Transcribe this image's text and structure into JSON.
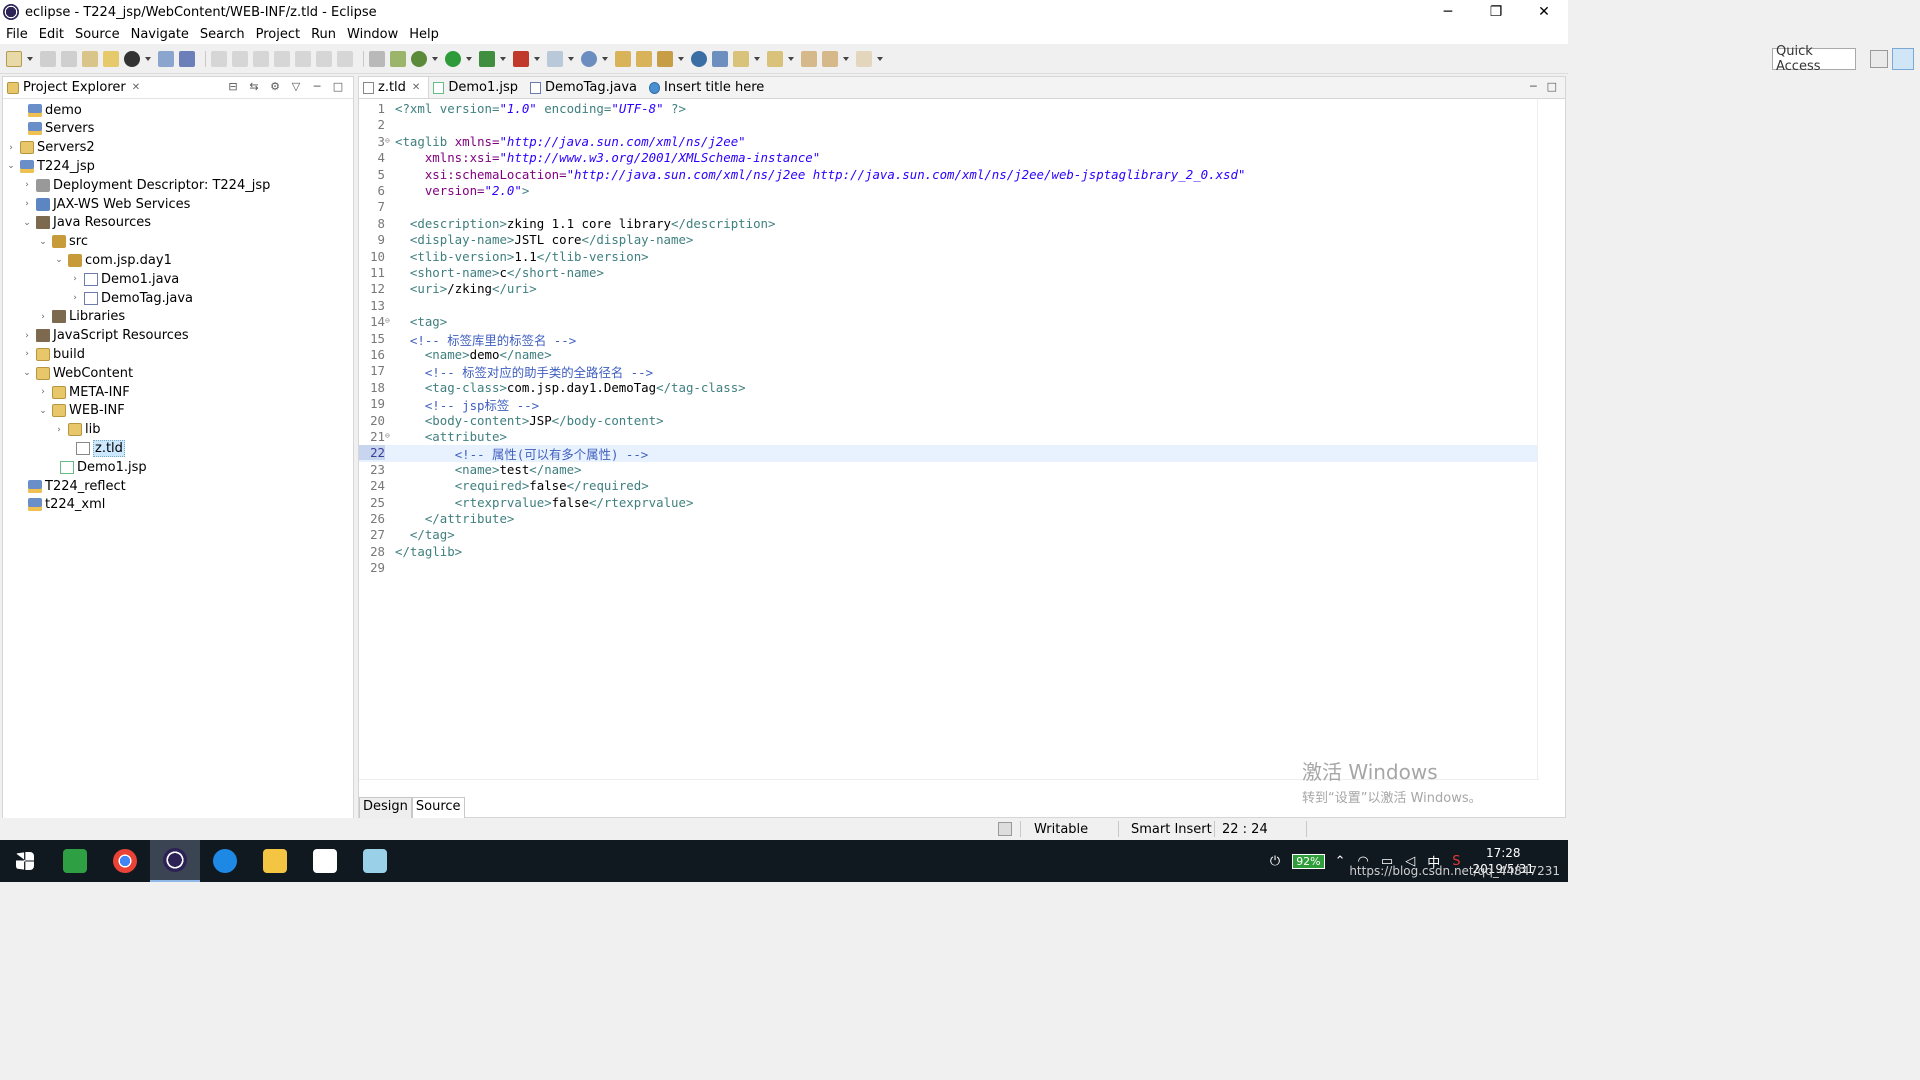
{
  "window": {
    "title": "eclipse - T224_jsp/WebContent/WEB-INF/z.tld - Eclipse",
    "minimize": "─",
    "restore": "❐",
    "close": "✕"
  },
  "menu": [
    "File",
    "Edit",
    "Source",
    "Navigate",
    "Search",
    "Project",
    "Run",
    "Window",
    "Help"
  ],
  "quick_access": "Quick Access",
  "explorer": {
    "title": "Project Explorer",
    "close": "✕",
    "tree": [
      {
        "label": "demo",
        "icon": "project-icon",
        "twisty": ""
      },
      {
        "label": "Servers",
        "icon": "project-icon",
        "twisty": ""
      },
      {
        "label": "Servers2",
        "icon": "folder-icon",
        "twisty": "›"
      },
      {
        "label": "T224_jsp",
        "icon": "project-icon",
        "twisty": "⌄"
      },
      {
        "label": "Deployment Descriptor: T224_jsp",
        "icon": "descriptor-icon",
        "twisty": "›"
      },
      {
        "label": "JAX-WS Web Services",
        "icon": "webservice-icon",
        "twisty": "›"
      },
      {
        "label": "Java Resources",
        "icon": "java-resources-icon",
        "twisty": "⌄"
      },
      {
        "label": "src",
        "icon": "source-folder-icon",
        "twisty": "⌄"
      },
      {
        "label": "com.jsp.day1",
        "icon": "package-icon",
        "twisty": "⌄"
      },
      {
        "label": "Demo1.java",
        "icon": "java-file-icon",
        "twisty": "›"
      },
      {
        "label": "DemoTag.java",
        "icon": "java-file-icon",
        "twisty": "›"
      },
      {
        "label": "Libraries",
        "icon": "library-icon",
        "twisty": "›"
      },
      {
        "label": "JavaScript Resources",
        "icon": "library-icon",
        "twisty": "›"
      },
      {
        "label": "build",
        "icon": "folder-icon",
        "twisty": "›"
      },
      {
        "label": "WebContent",
        "icon": "folder-icon",
        "twisty": "⌄"
      },
      {
        "label": "META-INF",
        "icon": "folder-icon",
        "twisty": "›"
      },
      {
        "label": "WEB-INF",
        "icon": "folder-icon",
        "twisty": "⌄"
      },
      {
        "label": "lib",
        "icon": "folder-icon",
        "twisty": "›"
      },
      {
        "label": "z.tld",
        "icon": "xml-file-icon",
        "twisty": ""
      },
      {
        "label": "Demo1.jsp",
        "icon": "jsp-file-icon",
        "twisty": ""
      },
      {
        "label": "T224_reflect",
        "icon": "project-icon",
        "twisty": ""
      },
      {
        "label": "t224_xml",
        "icon": "project-icon",
        "twisty": ""
      }
    ]
  },
  "editor": {
    "tabs": [
      {
        "label": "z.tld",
        "close": "✕"
      },
      {
        "label": "Demo1.jsp"
      },
      {
        "label": "DemoTag.java"
      },
      {
        "label": "Insert title here"
      }
    ],
    "current_line": 22,
    "lines": [
      [
        [
          "pi",
          "<?xml version="
        ],
        [
          "val",
          "\"1.0\""
        ],
        [
          "pi",
          " encoding="
        ],
        [
          "val",
          "\"UTF-8\""
        ],
        [
          "pi",
          " ?>"
        ]
      ],
      [],
      [
        [
          "tag",
          "<taglib "
        ],
        [
          "attr",
          "xmlns="
        ],
        [
          "val",
          "\"http://java.sun.com/xml/ns/j2ee\""
        ]
      ],
      [
        [
          "txt",
          "    "
        ],
        [
          "attr",
          "xmlns:xsi="
        ],
        [
          "val",
          "\"http://www.w3.org/2001/XMLSchema-instance\""
        ]
      ],
      [
        [
          "txt",
          "    "
        ],
        [
          "attr",
          "xsi:schemaLocation="
        ],
        [
          "val",
          "\"http://java.sun.com/xml/ns/j2ee http://java.sun.com/xml/ns/j2ee/web-jsptaglibrary_2_0.xsd\""
        ]
      ],
      [
        [
          "txt",
          "    "
        ],
        [
          "attr",
          "version="
        ],
        [
          "val",
          "\"2.0\""
        ],
        [
          "tag",
          ">"
        ]
      ],
      [],
      [
        [
          "txt",
          "  "
        ],
        [
          "tag",
          "<description>"
        ],
        [
          "txt",
          "zking 1.1 core library"
        ],
        [
          "tag",
          "</description>"
        ]
      ],
      [
        [
          "txt",
          "  "
        ],
        [
          "tag",
          "<display-name>"
        ],
        [
          "txt",
          "JSTL core"
        ],
        [
          "tag",
          "</display-name>"
        ]
      ],
      [
        [
          "txt",
          "  "
        ],
        [
          "tag",
          "<tlib-version>"
        ],
        [
          "txt",
          "1.1"
        ],
        [
          "tag",
          "</tlib-version>"
        ]
      ],
      [
        [
          "txt",
          "  "
        ],
        [
          "tag",
          "<short-name>"
        ],
        [
          "txt",
          "c"
        ],
        [
          "tag",
          "</short-name>"
        ]
      ],
      [
        [
          "txt",
          "  "
        ],
        [
          "tag",
          "<uri>"
        ],
        [
          "txt",
          "/zking"
        ],
        [
          "tag",
          "</uri>"
        ]
      ],
      [],
      [
        [
          "txt",
          "  "
        ],
        [
          "tag",
          "<tag>"
        ]
      ],
      [
        [
          "txt",
          "  "
        ],
        [
          "cmt",
          "<!-- 标签库里的标签名 -->"
        ]
      ],
      [
        [
          "txt",
          "    "
        ],
        [
          "tag",
          "<name>"
        ],
        [
          "txt",
          "demo"
        ],
        [
          "tag",
          "</name>"
        ]
      ],
      [
        [
          "txt",
          "    "
        ],
        [
          "cmt",
          "<!-- 标签对应的助手类的全路径名 -->"
        ]
      ],
      [
        [
          "txt",
          "    "
        ],
        [
          "tag",
          "<tag-class>"
        ],
        [
          "txt",
          "com.jsp.day1.DemoTag"
        ],
        [
          "tag",
          "</tag-class>"
        ]
      ],
      [
        [
          "txt",
          "    "
        ],
        [
          "cmt",
          "<!-- jsp标签 -->"
        ]
      ],
      [
        [
          "txt",
          "    "
        ],
        [
          "tag",
          "<body-content>"
        ],
        [
          "txt",
          "JSP"
        ],
        [
          "tag",
          "</body-content>"
        ]
      ],
      [
        [
          "txt",
          "    "
        ],
        [
          "tag",
          "<attribute>"
        ]
      ],
      [
        [
          "txt",
          "        "
        ],
        [
          "cmt",
          "<!-- 属性(可以有多个属性) -->"
        ]
      ],
      [
        [
          "txt",
          "        "
        ],
        [
          "tag",
          "<name>"
        ],
        [
          "txt",
          "test"
        ],
        [
          "tag",
          "</name>"
        ]
      ],
      [
        [
          "txt",
          "        "
        ],
        [
          "tag",
          "<required>"
        ],
        [
          "txt",
          "false"
        ],
        [
          "tag",
          "</required>"
        ]
      ],
      [
        [
          "txt",
          "        "
        ],
        [
          "tag",
          "<rtexprvalue>"
        ],
        [
          "txt",
          "false"
        ],
        [
          "tag",
          "</rtexprvalue>"
        ]
      ],
      [
        [
          "txt",
          "    "
        ],
        [
          "tag",
          "</attribute>"
        ]
      ],
      [
        [
          "txt",
          "  "
        ],
        [
          "tag",
          "</tag>"
        ]
      ],
      [
        [
          "tag",
          "</taglib>"
        ]
      ],
      []
    ],
    "folds": [
      3,
      14,
      21
    ],
    "modes": [
      "Design",
      "Source"
    ]
  },
  "watermark": {
    "line1": "激活 Windows",
    "line2": "转到“设置”以激活 Windows。"
  },
  "status": {
    "writable": "Writable",
    "insert": "Smart Insert",
    "position": "22 : 24"
  },
  "taskbar": {
    "battery": "92%",
    "ime": "中",
    "time": "17:28",
    "date": "2019/5/31",
    "url": "https://blog.csdn.net/qq_44847231"
  }
}
